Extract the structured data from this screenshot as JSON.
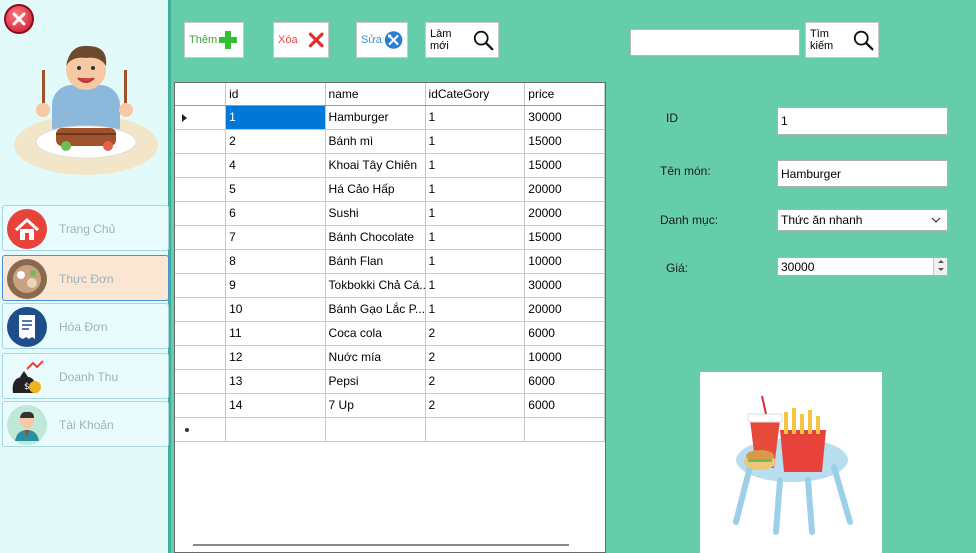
{
  "sidebar": {
    "items": [
      {
        "label": "Trang Chủ",
        "icon": "home-icon"
      },
      {
        "label": "Thực Đơn",
        "icon": "menu-food-icon"
      },
      {
        "label": "Hóa Đơn",
        "icon": "invoice-icon"
      },
      {
        "label": "Doanh Thu",
        "icon": "revenue-icon"
      },
      {
        "label": "Tài Khoản",
        "icon": "account-icon"
      }
    ],
    "active_index": 1
  },
  "toolbar": {
    "add_label": "Thêm",
    "delete_label": "Xóa",
    "edit_label": "Sửa",
    "refresh_label": "Làm mới",
    "search_label": "Tìm kiếm",
    "search_value": ""
  },
  "grid": {
    "columns": [
      "id",
      "name",
      "idCateGory",
      "price"
    ],
    "rows": [
      {
        "id": "1",
        "name": "Hamburger",
        "cat": "1",
        "price": "30000"
      },
      {
        "id": "2",
        "name": "Bánh mì",
        "cat": "1",
        "price": "15000"
      },
      {
        "id": "4",
        "name": "Khoai Tây Chiên",
        "cat": "1",
        "price": "15000"
      },
      {
        "id": "5",
        "name": "Há Cảo Hấp",
        "cat": "1",
        "price": "20000"
      },
      {
        "id": "6",
        "name": "Sushi",
        "cat": "1",
        "price": "20000"
      },
      {
        "id": "7",
        "name": "Bánh Chocolate",
        "cat": "1",
        "price": "15000"
      },
      {
        "id": "8",
        "name": "Bánh Flan",
        "cat": "1",
        "price": "10000"
      },
      {
        "id": "9",
        "name": "Tokbokki Chả Cá...",
        "cat": "1",
        "price": "30000"
      },
      {
        "id": "10",
        "name": "Bánh Gạo Lắc P...",
        "cat": "1",
        "price": "20000"
      },
      {
        "id": "11",
        "name": "Coca cola",
        "cat": "2",
        "price": "6000"
      },
      {
        "id": "12",
        "name": "Nuớc mía",
        "cat": "2",
        "price": "10000"
      },
      {
        "id": "13",
        "name": "Pepsi",
        "cat": "2",
        "price": "6000"
      },
      {
        "id": "14",
        "name": "7 Up",
        "cat": "2",
        "price": "6000"
      }
    ]
  },
  "form": {
    "id_label": "ID",
    "id_value": "1",
    "name_label": "Tên món:",
    "name_value": "Hamburger",
    "category_label": "Danh mục:",
    "category_value": "Thức ăn nhanh",
    "price_label": "Giá:",
    "price_value": "30000"
  }
}
